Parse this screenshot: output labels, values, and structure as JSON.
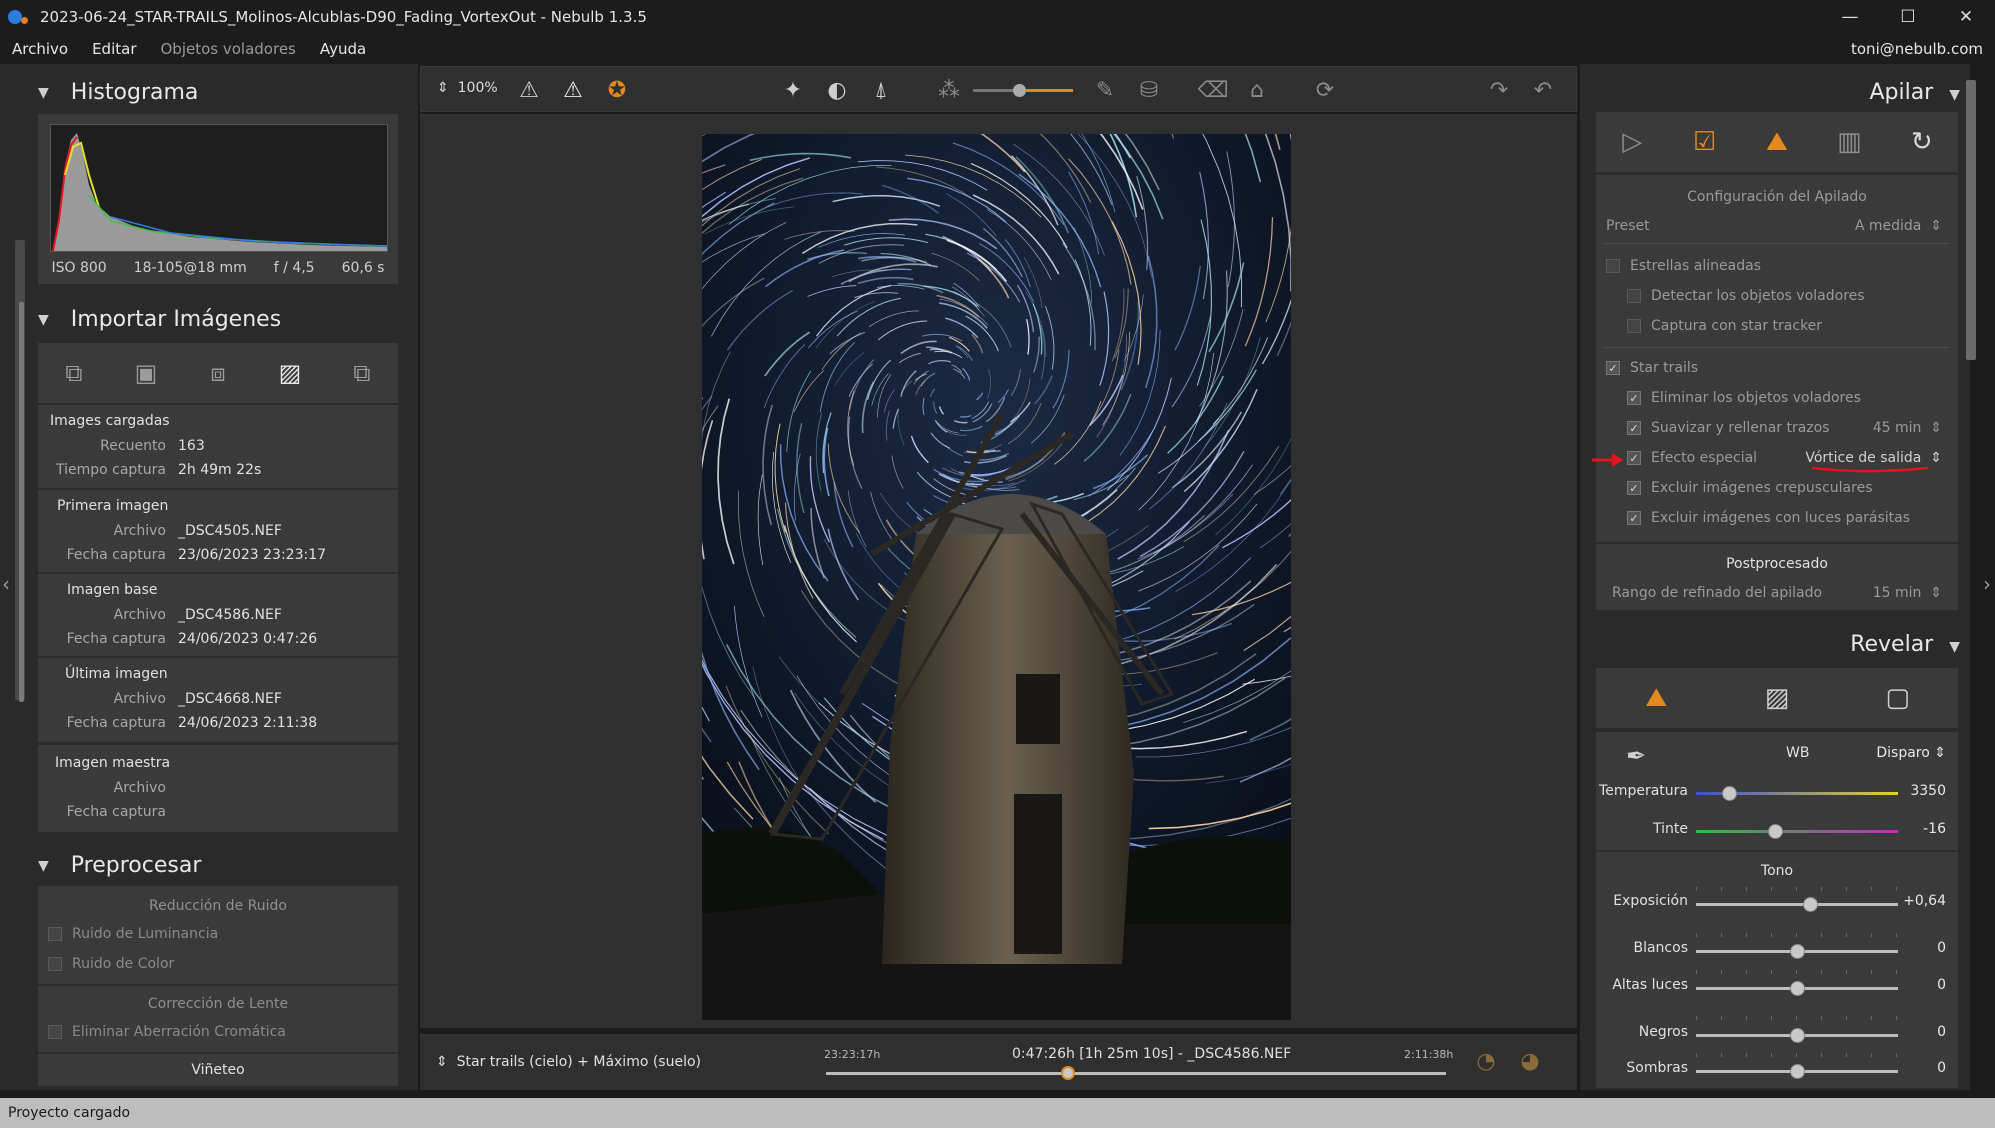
{
  "window": {
    "title": "2023-06-24_STAR-TRAILS_Molinos-Alcublas-D90_Fading_VortexOut - Nebulb 1.3.5",
    "minimize": "—",
    "maximize": "☐",
    "close": "✕"
  },
  "menu": {
    "items": [
      "Archivo",
      "Editar",
      "Objetos voladores",
      "Ayuda"
    ],
    "user": "toni@nebulb.com"
  },
  "histogram": {
    "title": "Histograma",
    "iso": "ISO 800",
    "lens": "18-105@18 mm",
    "aperture": "f / 4,5",
    "exposure": "60,6 s"
  },
  "import": {
    "title": "Importar Imágenes",
    "loaded": {
      "title": "Images cargadas",
      "count_label": "Recuento",
      "count": "163",
      "time_label": "Tiempo captura",
      "time": "2h 49m 22s"
    },
    "first": {
      "title": "Primera imagen",
      "file_label": "Archivo",
      "file": "_DSC4505.NEF",
      "date_label": "Fecha captura",
      "date": "23/06/2023 23:23:17"
    },
    "base": {
      "title": "Imagen base",
      "file_label": "Archivo",
      "file": "_DSC4586.NEF",
      "date_label": "Fecha captura",
      "date": "24/06/2023 0:47:26"
    },
    "last": {
      "title": "Última imagen",
      "file_label": "Archivo",
      "file": "_DSC4668.NEF",
      "date_label": "Fecha captura",
      "date": "24/06/2023 2:11:38"
    },
    "master": {
      "title": "Imagen maestra",
      "file_label": "Archivo",
      "date_label": "Fecha captura"
    }
  },
  "preprocess": {
    "title": "Preprocesar",
    "noise_title": "Reducción de Ruido",
    "luminance": "Ruido de Luminancia",
    "color": "Ruido de Color",
    "lens_title": "Corrección de Lente",
    "aberration": "Eliminar Aberración Cromática",
    "vignette": "Viñeteo"
  },
  "toolbar": {
    "zoom": "100%"
  },
  "timeline": {
    "mode": "Star trails (cielo) + Máximo (suelo)",
    "start": "23:23:17h",
    "current": "0:47:26h [1h 25m 10s] - _DSC4586.NEF",
    "end": "2:11:38h",
    "position": 0.39
  },
  "stack": {
    "title": "Apilar",
    "config_title": "Configuración del Apilado",
    "preset_label": "Preset",
    "preset_value": "A medida",
    "aligned": "Estrellas alineadas",
    "detect_flying": "Detectar los objetos voladores",
    "star_tracker": "Captura con star tracker",
    "star_trails": "Star trails",
    "remove_flying": "Eliminar los objetos voladores",
    "smooth": "Suavizar y rellenar trazos",
    "smooth_value": "45 min",
    "special": "Efecto especial",
    "special_value": "Vórtice de salida",
    "exclude_twilight": "Excluir imágenes crepusculares",
    "exclude_lights": "Excluir imágenes con luces parásitas",
    "post_title": "Postprocesado",
    "refine_label": "Rango de refinado del apilado",
    "refine_value": "15 min"
  },
  "reveal": {
    "title": "Revelar",
    "wb_label": "WB",
    "wb_value": "Disparo",
    "temp_label": "Temperatura",
    "temp_value": "3350",
    "tint_label": "Tinte",
    "tint_value": "-16",
    "tone_title": "Tono",
    "exposure_label": "Exposición",
    "exposure_value": "+0,64",
    "whites_label": "Blancos",
    "whites_value": "0",
    "highlights_label": "Altas luces",
    "highlights_value": "0",
    "blacks_label": "Negros",
    "blacks_value": "0",
    "shadows_label": "Sombras",
    "shadows_value": "0"
  },
  "status": {
    "text": "Proyecto cargado"
  },
  "colors": {
    "accent": "#e08a20",
    "annotation": "#e2141d"
  }
}
